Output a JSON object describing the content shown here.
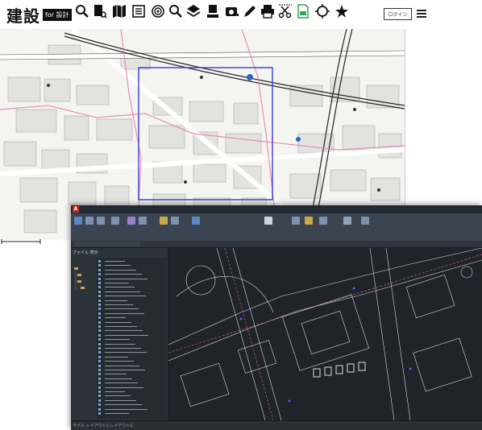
{
  "header": {
    "logo_text": "建設",
    "logo_badge": "for 設計",
    "login_label": "ログイン"
  },
  "toolbar": {
    "tools": [
      {
        "name": "search-icon"
      },
      {
        "name": "document-search-icon"
      },
      {
        "name": "map-icon"
      },
      {
        "name": "list-icon"
      },
      {
        "name": "radar-icon"
      },
      {
        "name": "zoom-icon"
      },
      {
        "name": "layers-icon"
      },
      {
        "name": "download-icon"
      },
      {
        "name": "camera-icon"
      },
      {
        "name": "pen-icon"
      },
      {
        "name": "print-icon"
      },
      {
        "name": "scissors-icon"
      },
      {
        "name": "file-export-icon"
      },
      {
        "name": "circle-tool-icon"
      },
      {
        "name": "star-icon"
      }
    ]
  },
  "cad": {
    "left_panel_title": "ファイル 表示",
    "status_text": "モデル  レイアウト1  レイアウト2"
  },
  "colors": {
    "map_background": "#f4f4f1",
    "selection_rectangle": "#3b3bd6",
    "cad_background": "#1f242a",
    "accent_red": "#c42b1c"
  }
}
